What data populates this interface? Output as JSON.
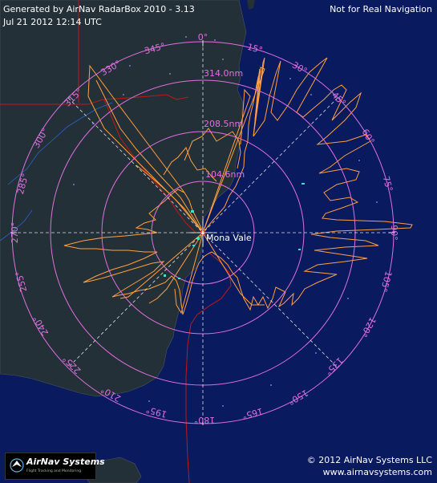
{
  "header": {
    "title": "Generated by AirNav RadarBox 2010 - 3.13",
    "timestamp": "Jul 21 2012 12:14 UTC",
    "disclaimer": "Not for Real Navigation"
  },
  "footer": {
    "copyright": "© 2012 AirNav Systems LLC",
    "website": "www.airnavsystems.com"
  },
  "logo": {
    "name": "AirNav Systems",
    "tagline": "Flight Tracking and Monitoring"
  },
  "map": {
    "center_label": "Mona Vale",
    "range_rings": [
      "104.6nm",
      "208.5nm",
      "314.0nm"
    ],
    "bearing_labels": [
      "0°",
      "15°",
      "30°",
      "45°",
      "60°",
      "75°",
      "90°",
      "105°",
      "120°",
      "135°",
      "150°",
      "165°",
      "180°",
      "195°",
      "210°",
      "225°",
      "240°",
      "255°",
      "270°",
      "285°",
      "300°",
      "315°",
      "330°",
      "345°"
    ],
    "colors": {
      "ocean": "#0a1a5e",
      "land": "#243038",
      "coverage": "#ffa040",
      "rings": "#e070e0",
      "labels": "#e070e0",
      "crosshair": "#ffffff",
      "border": "#c01818",
      "text": "#ffffff"
    }
  }
}
